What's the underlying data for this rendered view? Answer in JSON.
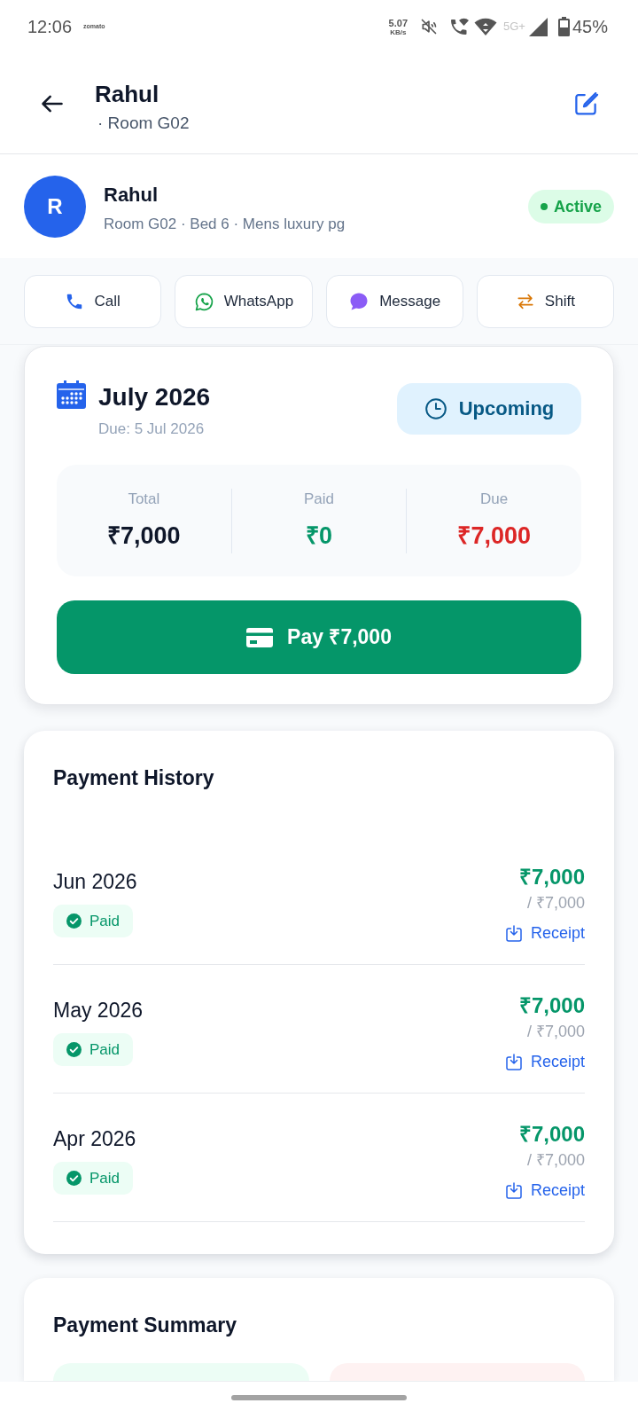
{
  "status_bar": {
    "time": "12:06",
    "notification": "zomato",
    "speed": "5.07",
    "speed_unit": "KB/s",
    "network": "5G+",
    "battery": "45%"
  },
  "header": {
    "title": "Rahul",
    "subtitle": "· Room G02"
  },
  "profile": {
    "initial": "R",
    "name": "Rahul",
    "details": "Room G02 · Bed 6 · Mens luxury pg",
    "status": "Active"
  },
  "actions": [
    {
      "kind": "call",
      "label": "Call"
    },
    {
      "kind": "whatsapp",
      "label": "WhatsApp"
    },
    {
      "kind": "message",
      "label": "Message"
    },
    {
      "kind": "shift",
      "label": "Shift"
    }
  ],
  "current_month": {
    "title": "July 2026",
    "due_date": "Due: 5 Jul 2026",
    "status": "Upcoming",
    "stats": [
      {
        "kind": "total",
        "label": "Total",
        "value": "₹7,000"
      },
      {
        "kind": "paid",
        "label": "Paid",
        "value": "₹0"
      },
      {
        "kind": "due",
        "label": "Due",
        "value": "₹7,000"
      }
    ],
    "pay_button": "Pay ₹7,000"
  },
  "payment_history": {
    "title": "Payment History",
    "rows": [
      {
        "month": "Jun 2026",
        "status": "Paid",
        "amount": "₹7,000",
        "total": "/ ₹7,000",
        "receipt": "Receipt"
      },
      {
        "month": "May 2026",
        "status": "Paid",
        "amount": "₹7,000",
        "total": "/ ₹7,000",
        "receipt": "Receipt"
      },
      {
        "month": "Apr 2026",
        "status": "Paid",
        "amount": "₹7,000",
        "total": "/ ₹7,000",
        "receipt": "Receipt"
      }
    ]
  },
  "payment_summary": {
    "title": "Payment Summary",
    "tiles": [
      {
        "kind": "paid"
      },
      {
        "kind": "due"
      }
    ]
  }
}
